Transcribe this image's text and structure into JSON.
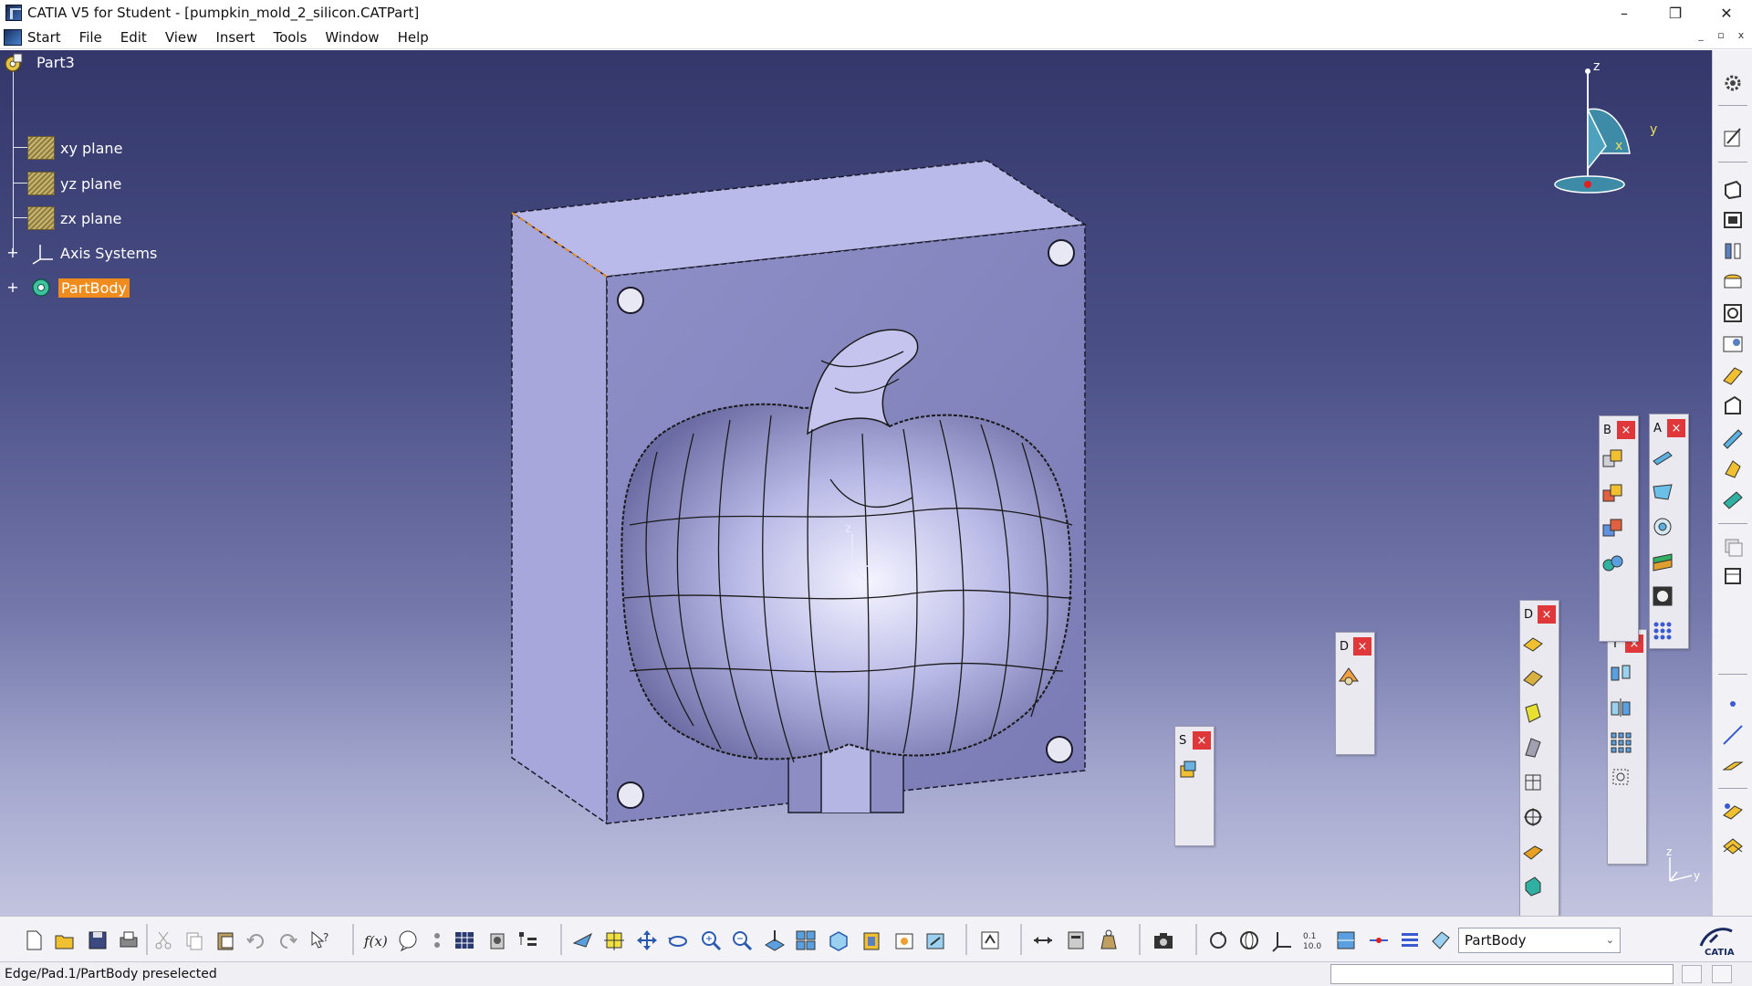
{
  "window": {
    "title": "CATIA V5 for Student - [pumpkin_mold_2_silicon.CATPart]",
    "controls": {
      "minimize": "–",
      "maximize": "❐",
      "close": "✕"
    }
  },
  "menu": {
    "items": [
      "Start",
      "File",
      "Edit",
      "View",
      "Insert",
      "Tools",
      "Window",
      "Help"
    ],
    "mdi": {
      "minimize": "_",
      "restore": "▫",
      "close": "x"
    }
  },
  "tree": {
    "root": "Part3",
    "nodes": [
      {
        "label": "xy plane",
        "icon": "plane-icon"
      },
      {
        "label": "yz plane",
        "icon": "plane-icon"
      },
      {
        "label": "zx plane",
        "icon": "plane-icon"
      },
      {
        "label": "Axis Systems",
        "icon": "axis-system-icon"
      },
      {
        "label": "PartBody",
        "icon": "body-icon",
        "selected": true
      }
    ]
  },
  "compass": {
    "z": "z",
    "y": "y",
    "x": "x"
  },
  "model_axes": {
    "z": "z",
    "y": "y"
  },
  "corner_axes": {
    "z": "z",
    "y": "y"
  },
  "floating_toolbars": [
    {
      "id": "S",
      "title": "S",
      "close": "×"
    },
    {
      "id": "D1",
      "title": "D",
      "close": "×"
    },
    {
      "id": "D2",
      "title": "D",
      "close": "×"
    },
    {
      "id": "T",
      "title": "T",
      "close": "×"
    },
    {
      "id": "B",
      "title": "B",
      "close": "×"
    },
    {
      "id": "A",
      "title": "A",
      "close": "×"
    }
  ],
  "bottom_toolbar": {
    "current_body": "PartBody",
    "dropdown_arrow": "⌄",
    "logo_text": "CATIA"
  },
  "statusbar": {
    "message": "Edge/Pad.1/PartBody preselected",
    "command_value": ""
  },
  "colors": {
    "selection": "#f08c1e",
    "viewport_top": "#33376a",
    "viewport_bottom": "#c2c4df",
    "part_face": "#a9a9e0",
    "close_button": "#e0383a"
  }
}
